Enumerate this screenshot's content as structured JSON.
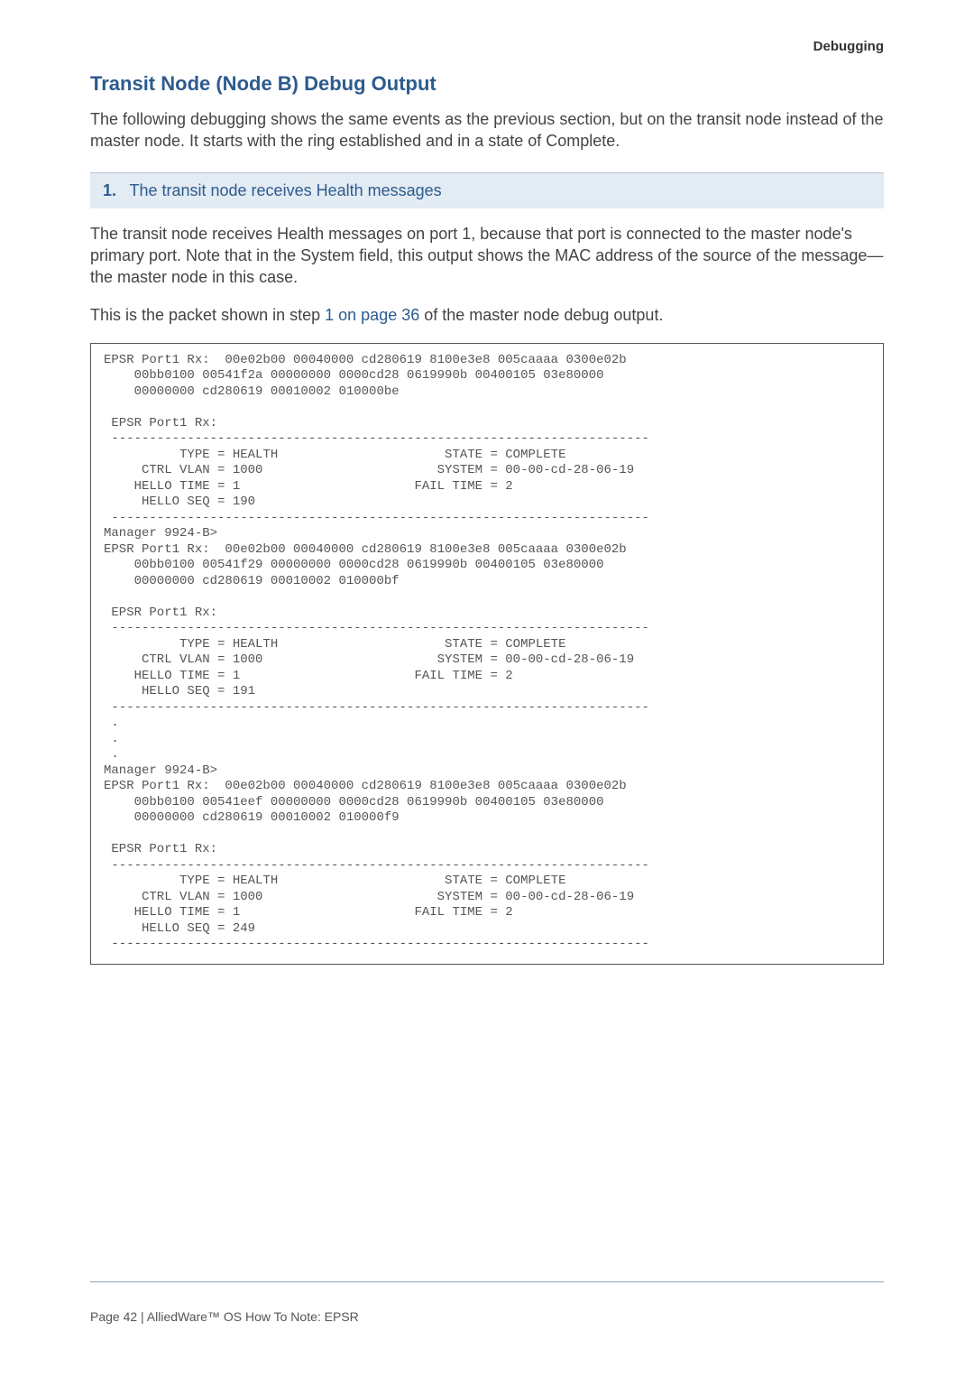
{
  "header": {
    "section": "Debugging"
  },
  "title": "Transit Node (Node B) Debug Output",
  "intro": "The following debugging shows the same events as the previous section, but on the transit node instead of the master node. It starts with the ring established and in a state of Complete.",
  "step": {
    "num": "1.",
    "label": "The transit node receives Health messages"
  },
  "para1": "The transit node receives Health messages on port 1, because that port is connected to the master node's primary port. Note that in the System field, this output shows the MAC address of the source of the message—the master node in this case.",
  "para2_pre": "This is the packet shown in step ",
  "para2_link": "1 on page 36",
  "para2_post": " of the master node debug output.",
  "console": "EPSR Port1 Rx:  00e02b00 00040000 cd280619 8100e3e8 005caaaa 0300e02b\n    00bb0100 00541f2a 00000000 0000cd28 0619990b 00400105 03e80000\n    00000000 cd280619 00010002 010000be\n\n EPSR Port1 Rx:\n -----------------------------------------------------------------------\n          TYPE = HEALTH                      STATE = COMPLETE\n     CTRL VLAN = 1000                       SYSTEM = 00-00-cd-28-06-19\n    HELLO TIME = 1                       FAIL TIME = 2\n     HELLO SEQ = 190\n -----------------------------------------------------------------------\nManager 9924-B>\nEPSR Port1 Rx:  00e02b00 00040000 cd280619 8100e3e8 005caaaa 0300e02b\n    00bb0100 00541f29 00000000 0000cd28 0619990b 00400105 03e80000\n    00000000 cd280619 00010002 010000bf\n\n EPSR Port1 Rx:\n -----------------------------------------------------------------------\n          TYPE = HEALTH                      STATE = COMPLETE\n     CTRL VLAN = 1000                       SYSTEM = 00-00-cd-28-06-19\n    HELLO TIME = 1                       FAIL TIME = 2\n     HELLO SEQ = 191\n -----------------------------------------------------------------------\n .\n .\n .\nManager 9924-B>\nEPSR Port1 Rx:  00e02b00 00040000 cd280619 8100e3e8 005caaaa 0300e02b\n    00bb0100 00541eef 00000000 0000cd28 0619990b 00400105 03e80000\n    00000000 cd280619 00010002 010000f9\n\n EPSR Port1 Rx:\n -----------------------------------------------------------------------\n          TYPE = HEALTH                      STATE = COMPLETE\n     CTRL VLAN = 1000                       SYSTEM = 00-00-cd-28-06-19\n    HELLO TIME = 1                       FAIL TIME = 2\n     HELLO SEQ = 249\n -----------------------------------------------------------------------",
  "footer": "Page 42 | AlliedWare™ OS How To Note: EPSR"
}
